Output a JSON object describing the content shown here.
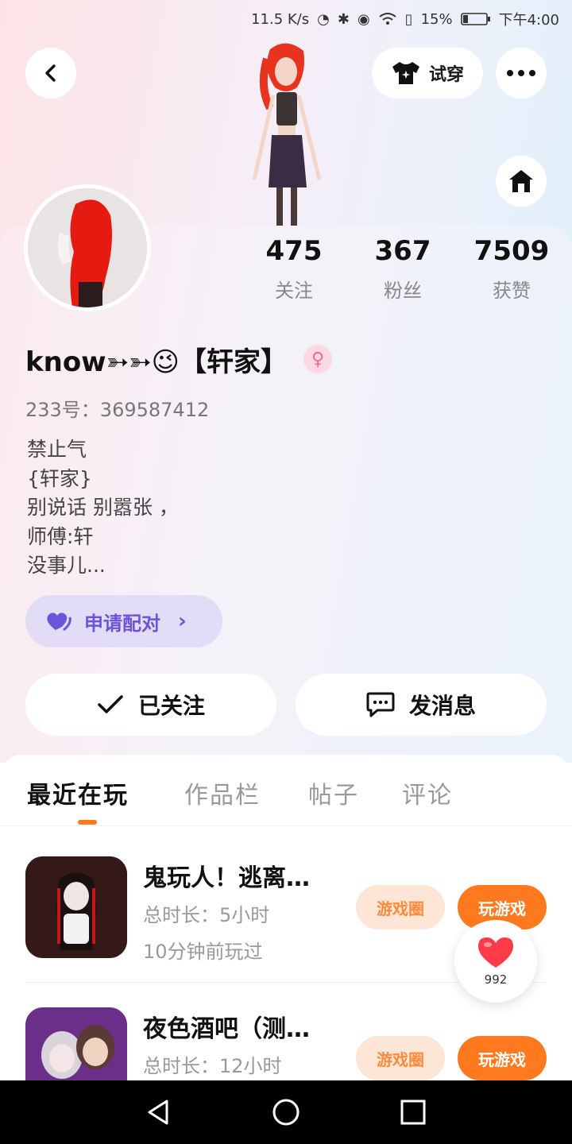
{
  "status_bar": {
    "speed": "11.5 K/s",
    "battery": "15%",
    "time": "下午4:00",
    "icons": [
      "data-icon",
      "bluetooth-icon",
      "eye-icon",
      "wifi-icon",
      "sim-alert-icon",
      "battery-icon"
    ]
  },
  "header": {
    "tryon_label": "试穿",
    "icons": {
      "back": "chevron-left-icon",
      "tryon": "shirt-icon",
      "more": "more-dots-icon",
      "home": "home-icon"
    }
  },
  "profile": {
    "stats": [
      {
        "value": "475",
        "label": "关注"
      },
      {
        "value": "367",
        "label": "粉丝"
      },
      {
        "value": "7509",
        "label": "获赞"
      }
    ],
    "username": "know➳➳😉【轩家】",
    "gender_symbol": "♀",
    "uid": "233号：369587412",
    "bio": [
      "禁止气",
      "{轩家}",
      "别说话 别嚣张 ，",
      "师傅:轩",
      "没事儿..."
    ],
    "pair_button": {
      "label": "申请配对",
      "arrow": "›"
    },
    "follow_button": "已关注",
    "message_button": "发消息"
  },
  "tabs": [
    "最近在玩",
    "作品栏",
    "帖子",
    "评论"
  ],
  "games": [
    {
      "title": "鬼玩人！逃离…",
      "playtime": "总时长：5小时",
      "last_played": "10分钟前玩过",
      "circle_label": "游戏圈",
      "play_label": "玩游戏"
    },
    {
      "title": "夜色酒吧（测…",
      "playtime": "总时长：12小时",
      "circle_label": "游戏圈",
      "play_label": "玩游戏"
    }
  ],
  "like_float": {
    "count": "992"
  },
  "colors": {
    "accent": "#ff7a1f",
    "pair": "#6a55d8",
    "gender": "#f06a94"
  }
}
